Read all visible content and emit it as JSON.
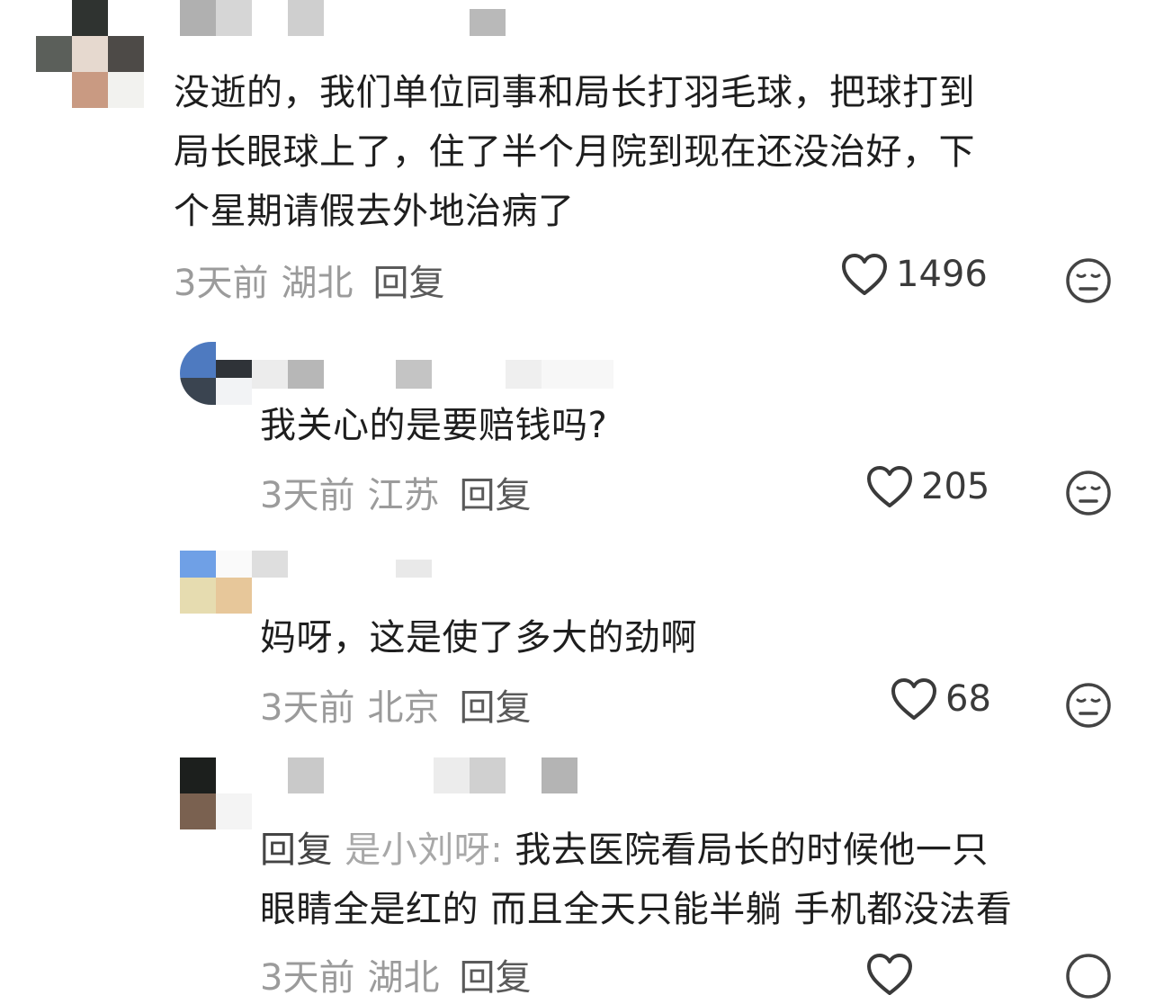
{
  "comments": [
    {
      "text": "没逝的，我们单位同事和局长打羽毛球，把球打到\n局长眼球上了，住了半个月院到现在还没治好，下\n个星期请假去外地治病了",
      "time": "3天前",
      "location": "湖北",
      "reply_label": "回复",
      "likes": "1496"
    },
    {
      "text": "我关心的是要赔钱吗?",
      "time": "3天前",
      "location": "江苏",
      "reply_label": "回复",
      "likes": "205"
    },
    {
      "text": "妈呀，这是使了多大的劲啊",
      "time": "3天前",
      "location": "北京",
      "reply_label": "回复",
      "likes": "68"
    },
    {
      "reply_prefix": "回复",
      "reply_target": "是小刘呀:",
      "text": "我去医院看局长的时候他一只\n眼睛全是红的 而且全天只能半躺 手机都没法看",
      "time": "3天前",
      "location": "湖北",
      "reply_label": "回复",
      "likes": ""
    }
  ],
  "icons": {
    "like": "heart-outline-icon",
    "reaction": "meh-face-icon"
  },
  "colors": {
    "text": "#1e1e1e",
    "meta": "#9b9b9b",
    "reply": "#5a5a5a",
    "reply_target": "#a8a8a8"
  }
}
